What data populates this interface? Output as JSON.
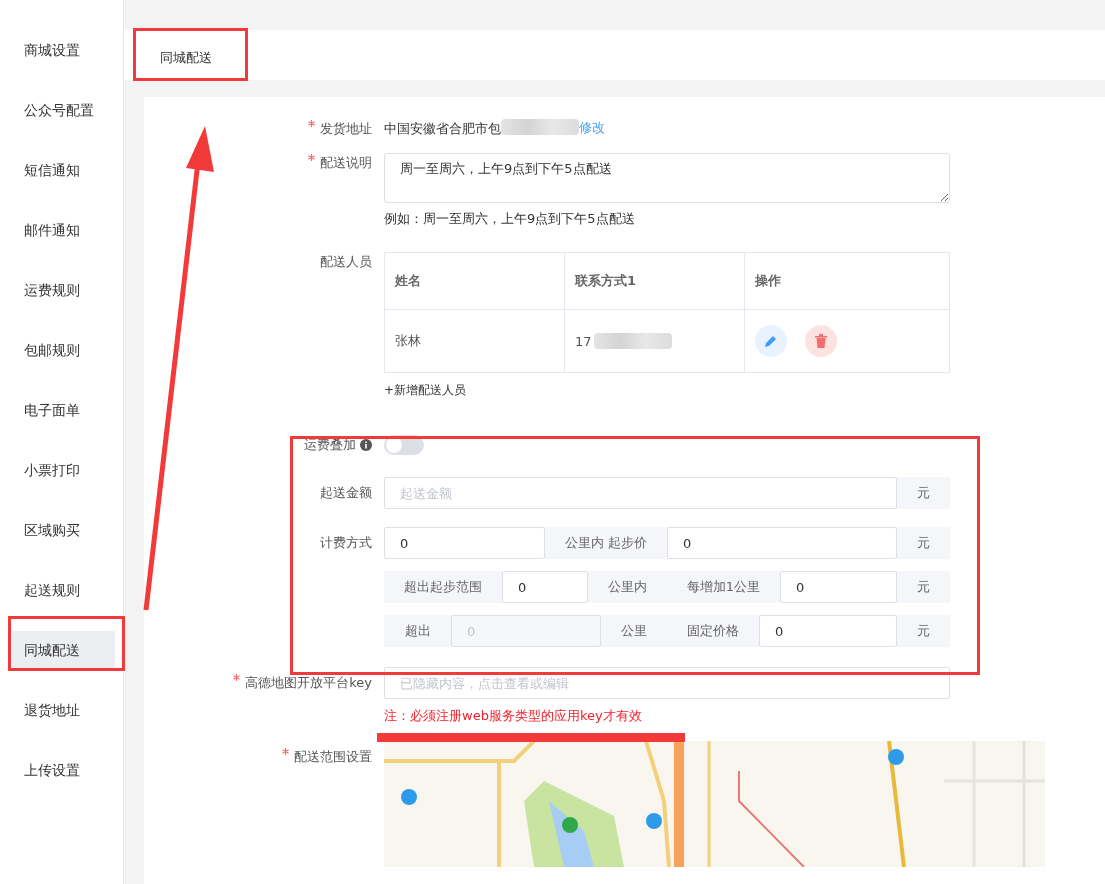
{
  "sidebar": {
    "items": [
      {
        "label": "商城设置",
        "selected": false
      },
      {
        "label": "公众号配置",
        "selected": false
      },
      {
        "label": "短信通知",
        "selected": false
      },
      {
        "label": "邮件通知",
        "selected": false
      },
      {
        "label": "运费规则",
        "selected": false
      },
      {
        "label": "包邮规则",
        "selected": false
      },
      {
        "label": "电子面单",
        "selected": false
      },
      {
        "label": "小票打印",
        "selected": false
      },
      {
        "label": "区域购买",
        "selected": false
      },
      {
        "label": "起送规则",
        "selected": false
      },
      {
        "label": "同城配送",
        "selected": true
      },
      {
        "label": "退货地址",
        "selected": false
      },
      {
        "label": "上传设置",
        "selected": false
      }
    ]
  },
  "tab": {
    "label": "同城配送"
  },
  "form": {
    "address": {
      "label": "发货地址",
      "required": true,
      "value": "中国安徽省合肥市包",
      "link": "修改"
    },
    "description": {
      "label": "配送说明",
      "required": true,
      "value": "周一至周六，上午9点到下午5点配送",
      "hint": "例如：周一至周六，上午9点到下午5点配送"
    },
    "staff": {
      "label": "配送人员",
      "columns": [
        "姓名",
        "联系方式1",
        "操作"
      ],
      "rows": [
        {
          "name": "张林",
          "phone": "17"
        }
      ],
      "add_link": "+新增配送人员"
    },
    "fee_stack": {
      "label": "运费叠加",
      "on": false
    },
    "min_amount": {
      "label": "起送金额",
      "placeholder": "起送金额",
      "unit": "元"
    },
    "billing": {
      "label": "计费方式",
      "rows": [
        {
          "segments": [
            {
              "kind": "input",
              "text": "0"
            },
            {
              "kind": "addon",
              "text": "公里内 起步价"
            },
            {
              "kind": "input",
              "text": "0"
            },
            {
              "kind": "addon",
              "text": "元"
            }
          ]
        },
        {
          "segments": [
            {
              "kind": "addon",
              "text": "超出起步范围"
            },
            {
              "kind": "input",
              "text": "0"
            },
            {
              "kind": "addon",
              "text": "公里内"
            },
            {
              "kind": "addon",
              "text": "每增加1公里"
            },
            {
              "kind": "input",
              "text": "0"
            },
            {
              "kind": "addon",
              "text": "元"
            }
          ]
        },
        {
          "segments": [
            {
              "kind": "addon",
              "text": "超出"
            },
            {
              "kind": "disabled",
              "text": "0"
            },
            {
              "kind": "addon",
              "text": "公里"
            },
            {
              "kind": "addon",
              "text": "固定价格"
            },
            {
              "kind": "input",
              "text": "0"
            },
            {
              "kind": "addon",
              "text": "元"
            }
          ]
        }
      ]
    },
    "amap_key": {
      "label": "高德地图开放平台key",
      "required": true,
      "placeholder": "已隐藏内容，点击查看或编辑",
      "note": "注：必须注册web服务类型的应用key才有效"
    },
    "range": {
      "label": "配送范围设置",
      "required": true
    }
  }
}
